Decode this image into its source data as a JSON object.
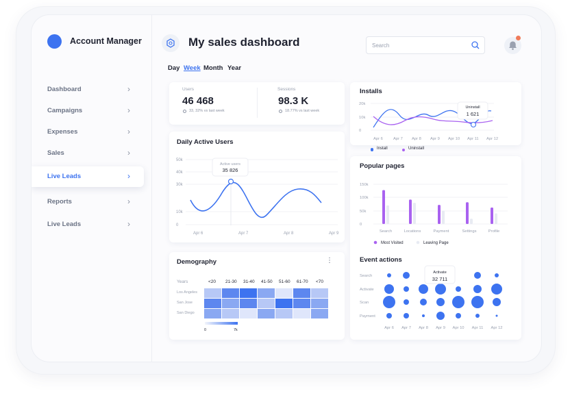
{
  "brand": "Account Manager",
  "title": "My sales dashboard",
  "search": {
    "placeholder": "Search"
  },
  "periods": [
    "Day",
    "Week",
    "Month",
    "Year"
  ],
  "period_active": "Week",
  "sidebar": {
    "items": [
      {
        "label": "Dashboard",
        "active": false
      },
      {
        "label": "Campaigns",
        "active": false
      },
      {
        "label": "Expenses",
        "active": false
      },
      {
        "label": "Sales",
        "active": false
      },
      {
        "label": "Live Leads",
        "active": true
      },
      {
        "label": "Reports",
        "active": false
      },
      {
        "label": "Live Leads",
        "active": false
      }
    ]
  },
  "stats": {
    "users": {
      "label": "Users",
      "value": "46 468",
      "sub": "33, 32% vs last week"
    },
    "sessions": {
      "label": "Sessions",
      "value": "98.3 K",
      "sub": "18.77% vs last week"
    }
  },
  "colors": {
    "accent": "#3d73f0",
    "purple": "#a962f0",
    "light": "#e8ebf3"
  },
  "chart_data": [
    {
      "id": "daily-active-users",
      "type": "line",
      "title": "Daily Active Users",
      "y_ticks": [
        "50k",
        "40k",
        "30k",
        "10k",
        "0"
      ],
      "x_ticks": [
        "Apr 6",
        "Apr 7",
        "Apr 8",
        "Apr 9"
      ],
      "tooltip": {
        "label": "Active users",
        "value": "35 826"
      }
    },
    {
      "id": "installs",
      "type": "line",
      "title": "Installs",
      "y_ticks": [
        "20k",
        "10k",
        "0"
      ],
      "x_ticks": [
        "Apr 6",
        "Apr 7",
        "Apr 8",
        "Apr 9",
        "Apr 10",
        "Apr 11",
        "Apr 12"
      ],
      "series": [
        {
          "name": "Install"
        },
        {
          "name": "Uninstall"
        }
      ],
      "tooltip": {
        "label": "Uninstall",
        "value": "1 621"
      }
    },
    {
      "id": "popular-pages",
      "type": "bar",
      "title": "Popular pages",
      "categories": [
        "Search",
        "Locations",
        "Payment",
        "Settings",
        "Profile"
      ],
      "y_ticks": [
        "150k",
        "100k",
        "50k",
        "0"
      ],
      "ylim": [
        0,
        150000
      ],
      "series": [
        {
          "name": "Most Visited",
          "values": [
            128000,
            92000,
            72000,
            82000,
            62000
          ]
        },
        {
          "name": "Leaving Page",
          "values": [
            70000,
            80000,
            50000,
            20000,
            40000
          ]
        }
      ]
    },
    {
      "id": "event-actions",
      "type": "scatter",
      "title": "Event actions",
      "rows": [
        "Search",
        "Activate",
        "Scan",
        "Payment"
      ],
      "x_ticks": [
        "Apr 6",
        "Apr 7",
        "Apr 8",
        "Apr 9",
        "Apr 10",
        "Apr 11",
        "Apr 12"
      ],
      "tooltip": {
        "label": "Activate",
        "value": "32 711"
      }
    },
    {
      "id": "demography",
      "type": "heatmap",
      "title": "Demography",
      "columns": [
        "Years",
        "<20",
        "21-30",
        "31-40",
        "41-50",
        "51-60",
        "61-70",
        "<70"
      ],
      "rows": [
        "Los Angeles",
        "San Jose",
        "San Diego"
      ],
      "scale": [
        "0",
        "7k"
      ]
    }
  ]
}
